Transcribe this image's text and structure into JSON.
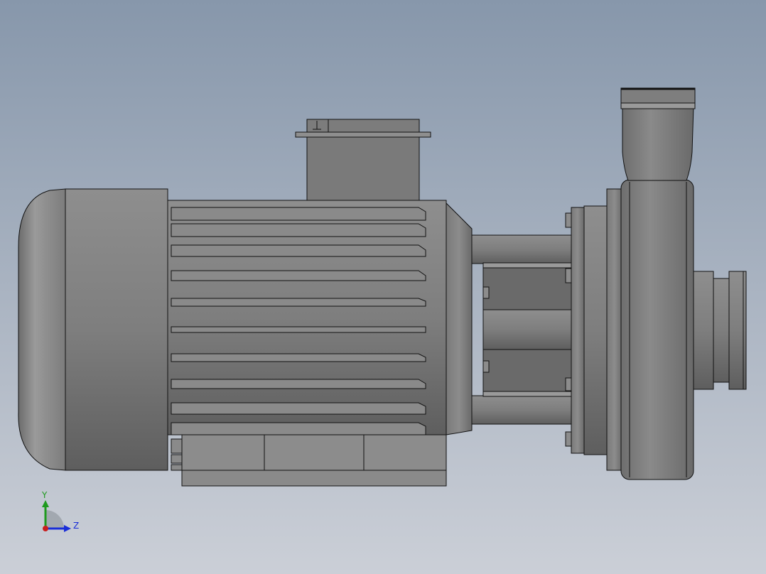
{
  "scene": {
    "model": "centrifugal-pump-with-electric-motor",
    "view": "side-orthographic",
    "background": {
      "top": "#8797AB",
      "bottom": "#CBCFD7"
    },
    "part_color": "#7C7C7C",
    "edge_color": "#111111"
  },
  "triad": {
    "y_label": "Y",
    "z_label": "Z",
    "y_color": "#1E9A1E",
    "z_color": "#1A2ED8",
    "x_color": "#C81E1E"
  }
}
